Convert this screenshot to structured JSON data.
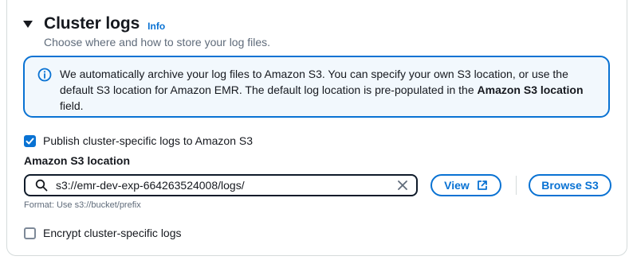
{
  "section": {
    "title": "Cluster logs",
    "info_link": "Info",
    "description": "Choose where and how to store your log files."
  },
  "alert": {
    "text_part1": "We automatically archive your log files to Amazon S3. You can specify your own S3 location, or use the default S3 location for Amazon EMR. The default log location is pre-populated in the ",
    "text_bold": "Amazon S3 location",
    "text_part2": " field."
  },
  "publish_logs": {
    "label": "Publish cluster-specific logs to Amazon S3",
    "checked": true
  },
  "s3_location": {
    "label": "Amazon S3 location",
    "value": "s3://emr-dev-exp-664263524008/logs/",
    "hint": "Format: Use s3://bucket/prefix"
  },
  "buttons": {
    "view": "View",
    "browse": "Browse S3"
  },
  "encrypt_logs": {
    "label": "Encrypt cluster-specific logs",
    "checked": false
  },
  "colors": {
    "accent": "#0972d3",
    "alert_bg": "#f2f8fd",
    "text": "#16191f",
    "muted": "#5f6b7a"
  }
}
